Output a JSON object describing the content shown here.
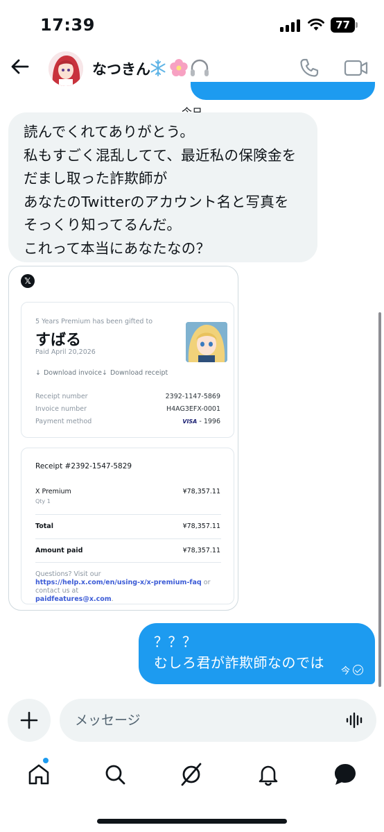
{
  "status_bar": {
    "time": "17:39",
    "battery": "77"
  },
  "header": {
    "name": "なつきん",
    "emoji_names": [
      "snowflake",
      "cherry-blossom",
      "headphones"
    ]
  },
  "chat": {
    "date_divider": "今日",
    "received_text": "読んでくれてありがとう。\n私もすごく混乱してて、最近私の保険金を\nだまし取った詐欺師が\nあなたのTwitterのアカウント名と写真を\nそっくり知ってるんだ。\nこれって本当にあなたなの？",
    "receipt": {
      "logo": "𝕏",
      "gift_note": "5 Years Premium has been gifted to",
      "recipient": "すばる",
      "paid_date": "Paid April 20,2026",
      "download_invoice": "Download invoice",
      "download_receipt": "Download receipt",
      "receipt_number_label": "Receipt number",
      "receipt_number": "2392-1147-5869",
      "invoice_number_label": "Invoice number",
      "invoice_number": "H4AG3EFX-0001",
      "payment_method_label": "Payment method",
      "card_brand": "VISA",
      "card_last4": "- 1996",
      "receipt_title": "Receipt #2392-1547-5829",
      "item_name": "X Premium",
      "item_qty": "Qty 1",
      "item_price": "¥78,357.11",
      "total_label": "Total",
      "total_value": "¥78,357.11",
      "amount_paid_label": "Amount paid",
      "amount_paid_value": "¥78,357.11",
      "footer_prefix": "Questions? Visit our",
      "footer_link": "https://help.x.com/en/using-x/x-premium-faq",
      "footer_middle": " or contact us at",
      "footer_email": "paidfeatures@x.com",
      "footer_suffix": "."
    },
    "sent_text": "？？？\nむしろ君が詐欺師なのでは",
    "sent_time": "今"
  },
  "composer": {
    "placeholder": "メッセージ"
  },
  "colors": {
    "accent": "#1d9bf0",
    "bubble_received": "#eff3f4",
    "text": "#0f1419"
  }
}
